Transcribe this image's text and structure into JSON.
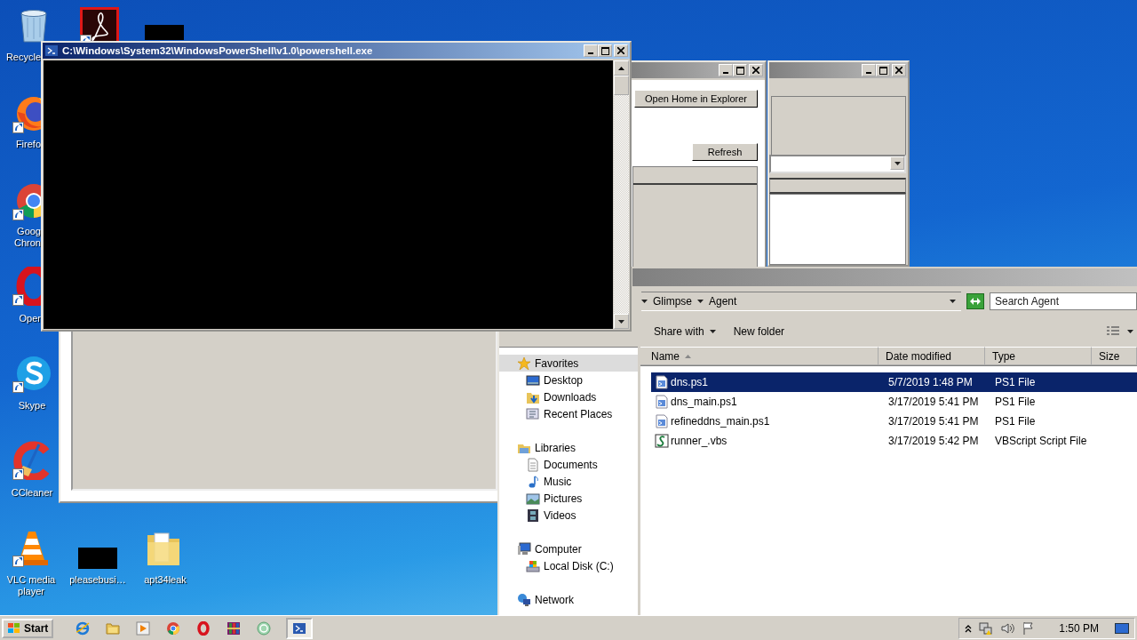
{
  "desktop": {
    "icons": [
      {
        "kind": "recycle-bin",
        "label": "Recycle",
        "shortcut": false
      },
      {
        "kind": "acrobat",
        "shortcut": true
      },
      {
        "kind": "thumbnail",
        "shortcut": false
      },
      {
        "kind": "firefox",
        "label": "Firefo",
        "shortcut": true
      },
      {
        "kind": "chrome",
        "label": "Goog Chron",
        "shortcut": true
      },
      {
        "kind": "opera",
        "label": "Oper",
        "shortcut": true
      },
      {
        "kind": "skype",
        "label": "Skype",
        "shortcut": true
      },
      {
        "kind": "ccleaner",
        "label": "CCleaner",
        "shortcut": true
      },
      {
        "kind": "vlc",
        "label": "VLC media player",
        "shortcut": true
      },
      {
        "kind": "thumbnail",
        "label": "pleasebusi…",
        "shortcut": false
      },
      {
        "kind": "folder",
        "label": "apt34leak",
        "shortcut": false
      }
    ]
  },
  "form_windows": [
    {
      "kind": "button-panel",
      "active": false,
      "buttons": [
        "Open Home in Explorer",
        "Refresh"
      ]
    },
    {
      "kind": "combo-panel",
      "active": false
    }
  ],
  "explorer": {
    "active": false,
    "breadcrumb": [
      "Glimpse",
      "Agent"
    ],
    "search": {
      "placeholder": "Search Agent"
    },
    "toolbar": [
      {
        "label": "Share with",
        "dropdown": true
      },
      {
        "label": "New folder",
        "dropdown": false
      }
    ],
    "nav": [
      {
        "label": "Favorites",
        "kind": "favorites",
        "selected": true,
        "children": [
          {
            "label": "Desktop",
            "kind": "desktop",
            "selected": false
          },
          {
            "label": "Downloads",
            "kind": "downloads",
            "selected": false
          },
          {
            "label": "Recent Places",
            "kind": "recent",
            "selected": false
          }
        ]
      },
      {
        "label": "Libraries",
        "kind": "libraries",
        "selected": false,
        "children": [
          {
            "label": "Documents",
            "kind": "documents",
            "selected": false
          },
          {
            "label": "Music",
            "kind": "music",
            "selected": false
          },
          {
            "label": "Pictures",
            "kind": "pictures",
            "selected": false
          },
          {
            "label": "Videos",
            "kind": "videos",
            "selected": false
          }
        ]
      },
      {
        "label": "Computer",
        "kind": "computer",
        "selected": false,
        "children": [
          {
            "label": "Local Disk (C:)",
            "kind": "disk",
            "selected": false
          }
        ]
      },
      {
        "label": "Network",
        "kind": "network",
        "selected": false
      }
    ],
    "columns": [
      {
        "label": "Name",
        "sorted": true
      },
      {
        "label": "Date modified",
        "sorted": false
      },
      {
        "label": "Type",
        "sorted": false
      },
      {
        "label": "Size",
        "sorted": false
      }
    ],
    "rows": [
      {
        "name": "dns.ps1",
        "date": "5/7/2019 1:48 PM",
        "type": "PS1 File",
        "kind": "ps1",
        "selected": true
      },
      {
        "name": "dns_main.ps1",
        "date": "3/17/2019 5:41 PM",
        "type": "PS1 File",
        "kind": "ps1",
        "selected": false
      },
      {
        "name": "refineddns_main.ps1",
        "date": "3/17/2019 5:41 PM",
        "type": "PS1 File",
        "kind": "ps1",
        "selected": false
      },
      {
        "name": "runner_.vbs",
        "date": "3/17/2019 5:42 PM",
        "type": "VBScript Script File",
        "kind": "vbs",
        "selected": false
      }
    ]
  },
  "powershell": {
    "title": "C:\\Windows\\System32\\WindowsPowerShell\\v1.0\\powershell.exe",
    "active": true
  },
  "taskbar": {
    "start": "Start",
    "apps": [
      {
        "kind": "ie",
        "active": false
      },
      {
        "kind": "explorer",
        "active": false
      },
      {
        "kind": "media-player",
        "active": false
      },
      {
        "kind": "chrome",
        "active": false
      },
      {
        "kind": "opera",
        "active": false
      },
      {
        "kind": "winrar",
        "active": false
      },
      {
        "kind": "ring-app",
        "active": false
      },
      {
        "kind": "powershell",
        "active": true
      }
    ],
    "clock": "1:50 PM"
  }
}
